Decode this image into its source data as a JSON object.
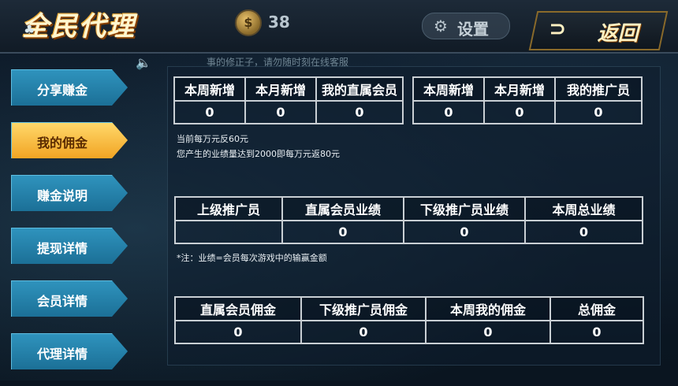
{
  "header": {
    "title": "全民代理",
    "coins": "38",
    "settings_label": "设置",
    "back_label": "返回"
  },
  "marquee": {
    "text": "事的修正子，请勿随时刻在线客服"
  },
  "sidebar": {
    "items": [
      {
        "label": "分享赚金"
      },
      {
        "label": "我的佣金"
      },
      {
        "label": "赚金说明"
      },
      {
        "label": "提现详情"
      },
      {
        "label": "会员详情"
      },
      {
        "label": "代理详情"
      }
    ],
    "active_index": 1
  },
  "stats_members": {
    "headers": [
      "本周新增",
      "本月新增",
      "我的直属会员"
    ],
    "values": [
      "0",
      "0",
      "0"
    ]
  },
  "stats_promoters": {
    "headers": [
      "本周新增",
      "本月新增",
      "我的推广员"
    ],
    "values": [
      "0",
      "0",
      "0"
    ]
  },
  "rate_notes": {
    "line1": "当前每万元反60元",
    "line2": "您产生的业绩量达到2000即每万元返80元"
  },
  "performance": {
    "headers": [
      "上级推广员",
      "直属会员业绩",
      "下级推广员业绩",
      "本周总业绩"
    ],
    "values": [
      "",
      "0",
      "0",
      "0"
    ]
  },
  "performance_note": "*注：业绩=会员每次游戏中的输赢金额",
  "commission": {
    "headers": [
      "直属会员佣金",
      "下级推广员佣金",
      "本周我的佣金",
      "总佣金"
    ],
    "values": [
      "0",
      "0",
      "0",
      "0"
    ]
  },
  "colors": {
    "active_tab": "#f1a322",
    "tab": "#1b6f96",
    "grid_border": "#c9cfd4"
  }
}
